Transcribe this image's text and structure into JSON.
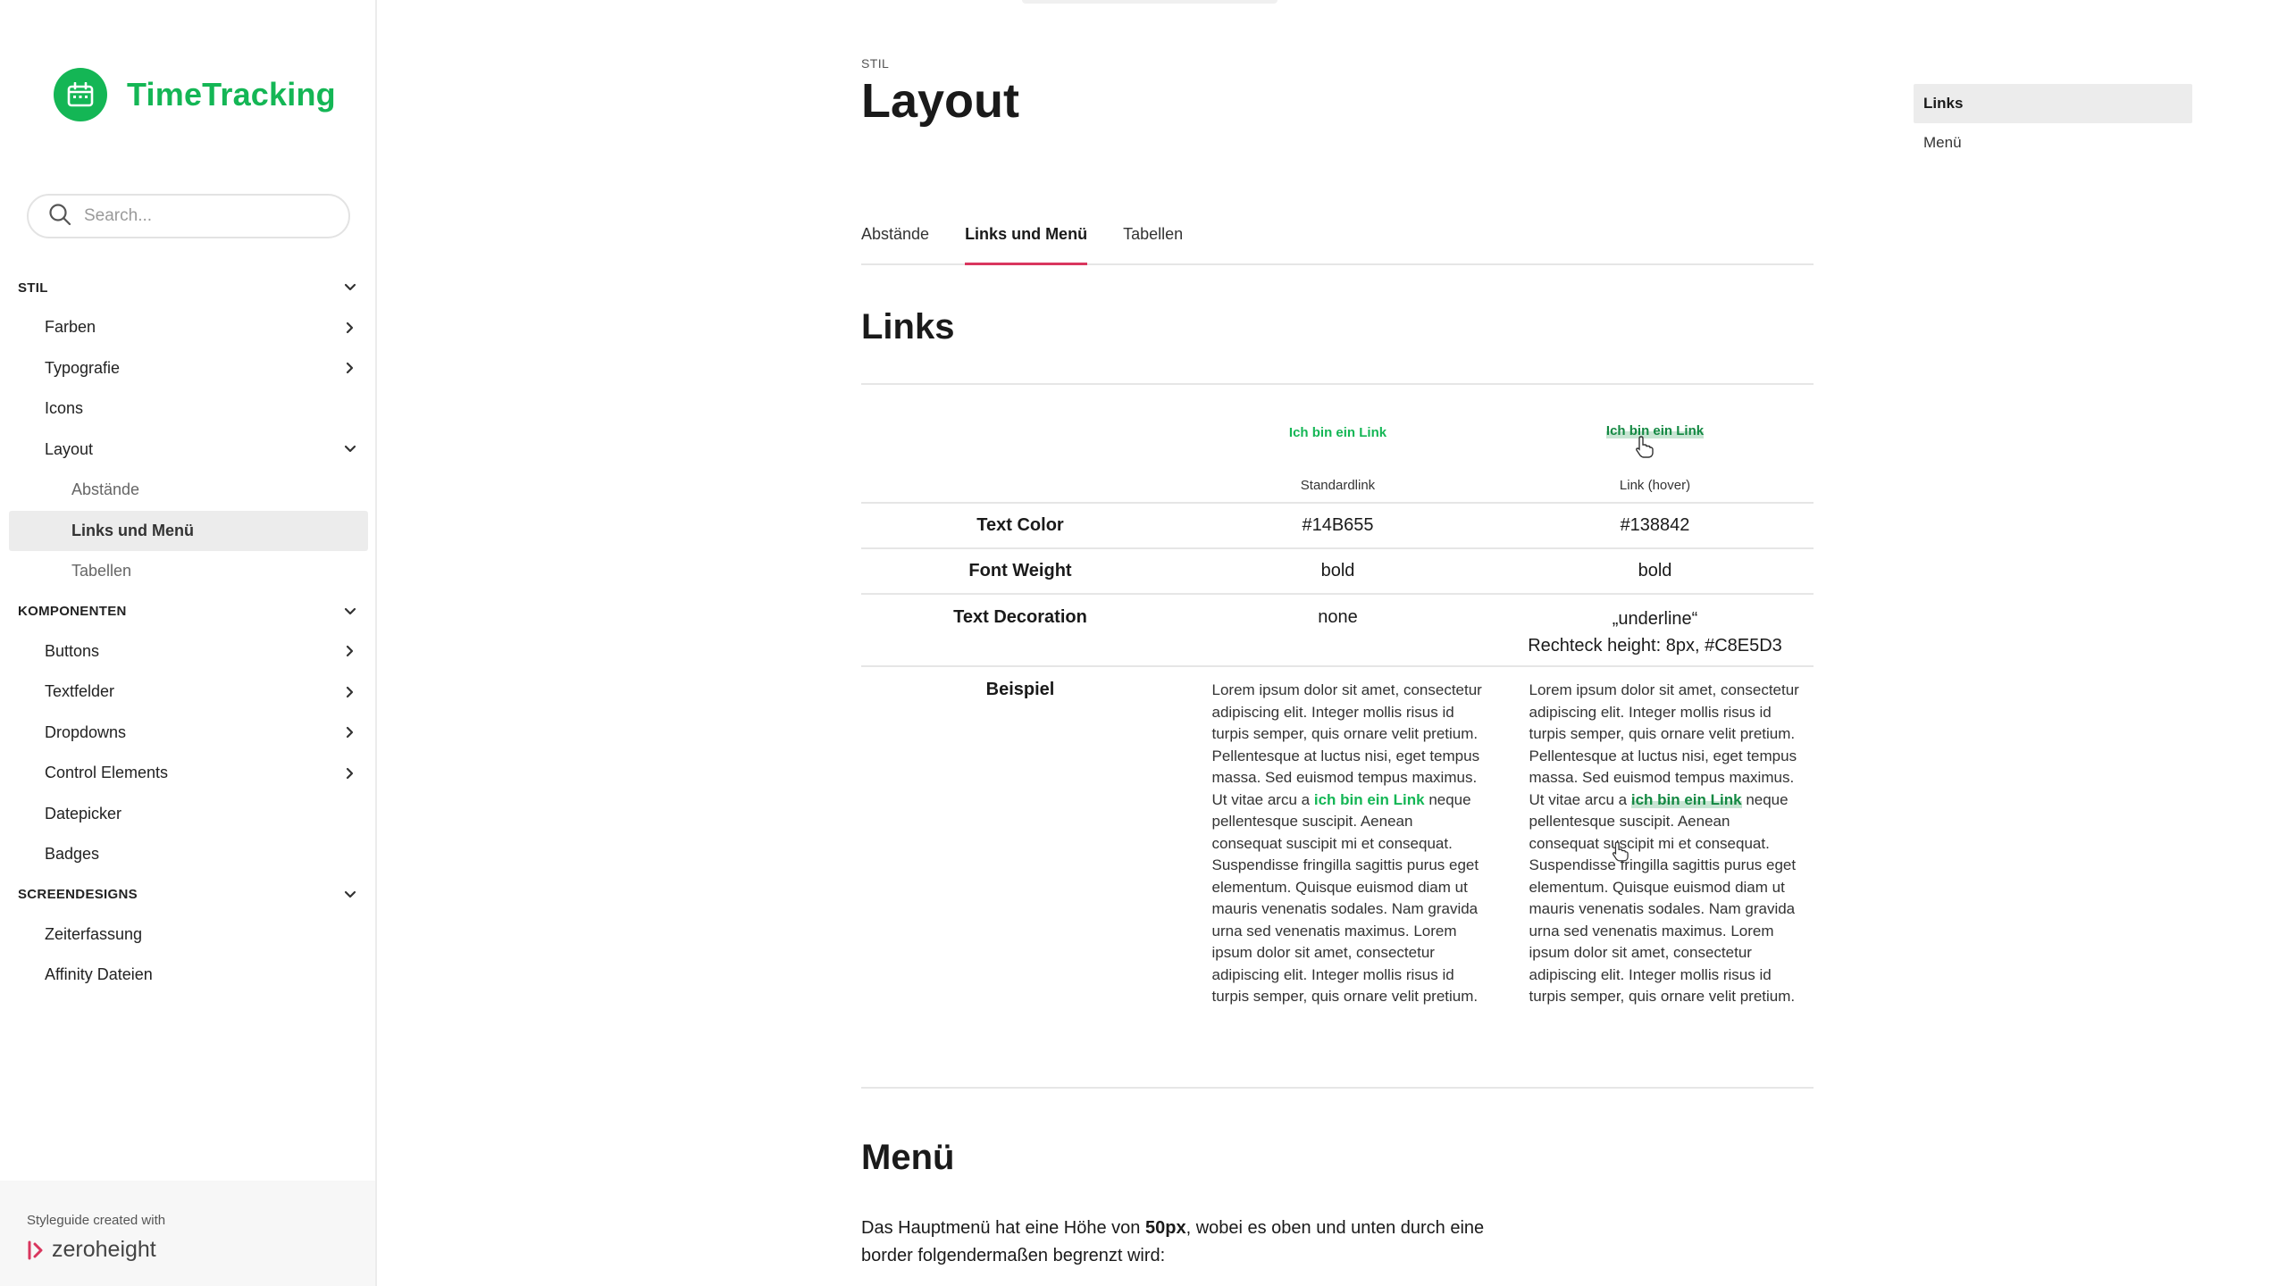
{
  "app": {
    "name": "TimeTracking",
    "accent": "#14B655"
  },
  "search": {
    "placeholder": "Search..."
  },
  "nav": {
    "sections": [
      {
        "label": "STIL",
        "items": [
          {
            "label": "Farben"
          },
          {
            "label": "Typografie"
          },
          {
            "label": "Icons"
          },
          {
            "label": "Layout",
            "sub": [
              "Abstände",
              "Links und Menü",
              "Tabellen"
            ]
          }
        ]
      },
      {
        "label": "KOMPONENTEN",
        "items": [
          {
            "label": "Buttons"
          },
          {
            "label": "Textfelder"
          },
          {
            "label": "Dropdowns"
          },
          {
            "label": "Control Elements"
          },
          {
            "label": "Datepicker"
          },
          {
            "label": "Badges"
          }
        ]
      },
      {
        "label": "SCREENDESIGNS",
        "items": [
          {
            "label": "Zeiterfassung"
          },
          {
            "label": "Affinity Dateien"
          }
        ]
      }
    ],
    "active_sub": "Links und Menü"
  },
  "footer": {
    "note": "Styleguide created with",
    "brand": "zeroheight"
  },
  "page": {
    "eyebrow": "STIL",
    "title": "Layout",
    "tabs": [
      "Abstände",
      "Links und Menü",
      "Tabellen"
    ],
    "active_tab": "Links und Menü"
  },
  "links_section": {
    "heading": "Links",
    "demo_link": "Ich bin ein Link",
    "col_standard": "Standardlink",
    "col_hover": "Link (hover)",
    "rows": [
      {
        "label": "Text Color",
        "standard": "#14B655",
        "hover": "#138842"
      },
      {
        "label": "Font Weight",
        "standard": "bold",
        "hover": "bold"
      },
      {
        "label": "Text Decoration",
        "standard": "none",
        "hover": "„underline“",
        "hover_2": "Rechteck height: 8px, #C8E5D3"
      },
      {
        "label": "Beispiel"
      }
    ],
    "example_before": "Lorem ipsum dolor sit amet, consectetur adipiscing elit. Integer mollis risus id turpis semper, quis ornare velit pretium. Pellentesque at luctus nisi, eget tempus massa. Sed euismod tempus maximus. Ut vitae arcu a",
    "example_link": "ich bin ein Link",
    "example_after": "neque pellentesque suscipit. Aenean consequat suscipit mi et consequat. Suspendisse fringilla sagittis purus eget elementum. Quisque euismod diam ut mauris venenatis sodales. Nam gravida urna sed venenatis maximus. Lorem ipsum dolor sit amet, consectetur adipiscing elit. Integer mollis risus id turpis semper, quis ornare velit pretium.",
    "colors": {
      "standard": "#14B655",
      "hover": "#138842",
      "underline": "#C8E5D3"
    }
  },
  "menu_section": {
    "heading": "Menü",
    "para_before": "Das Hauptmenü hat eine Höhe von",
    "para_bold": "50px",
    "para_after": ", wobei es oben und unten durch eine border folgendermaßen begrenzt wird:"
  },
  "toc": {
    "items": [
      "Links",
      "Menü"
    ],
    "active": "Links"
  }
}
